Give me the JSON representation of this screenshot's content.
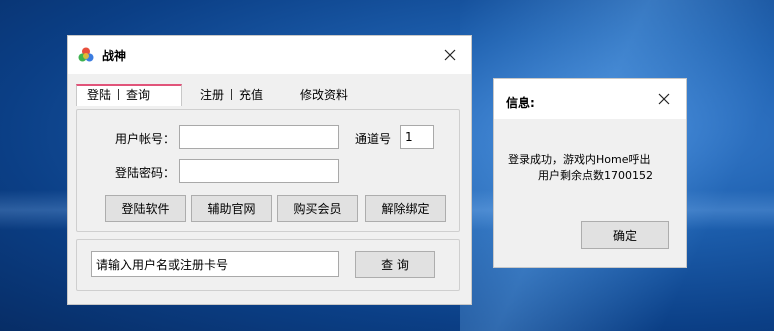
{
  "main_window": {
    "title": "战神",
    "tabs": [
      {
        "label_a": "登陆",
        "label_b": "查询"
      },
      {
        "label_a": "注册",
        "label_b": "充值"
      },
      {
        "label": "修改资料"
      }
    ],
    "form": {
      "username_label": "用户帐号：",
      "username_value": "",
      "channel_label": "通道号",
      "channel_value": "1",
      "password_label": "登陆密码：",
      "password_value": ""
    },
    "buttons": {
      "login": "登陆软件",
      "website": "辅助官网",
      "buy_vip": "购买会员",
      "unbind": "解除绑定"
    },
    "query": {
      "input_value": "请输入用户名或注册卡号",
      "button": "查  询"
    }
  },
  "info_dialog": {
    "title": "信息:",
    "message_line1": "登录成功，游戏内Home呼出",
    "message_line2": "用户剩余点数1700152",
    "ok_button": "确定"
  },
  "colors": {
    "active_tab_accent": "#e1547a",
    "desktop_blue": "#1d5fae"
  }
}
